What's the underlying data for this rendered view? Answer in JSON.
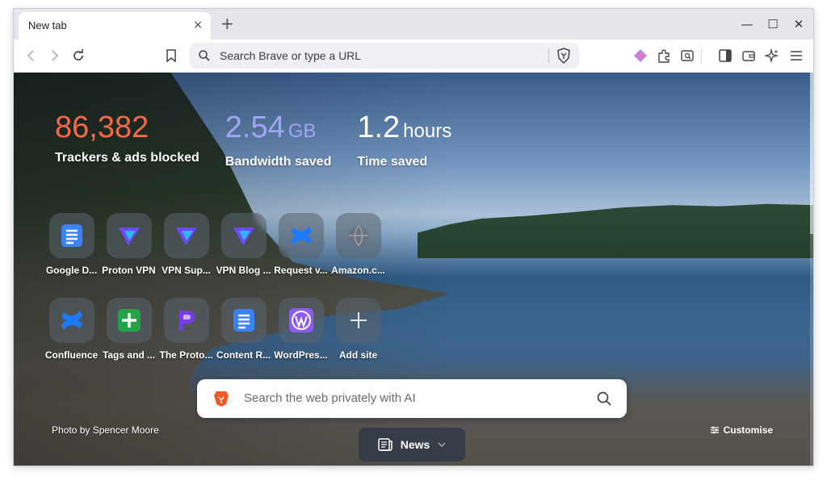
{
  "tab": {
    "title": "New tab",
    "close": "×",
    "new": "+"
  },
  "window": {
    "minimize": "—",
    "maximize": "☐",
    "close": "✕"
  },
  "omnibox": {
    "placeholder": "Search Brave or type a URL"
  },
  "stats": [
    {
      "value": "86,382",
      "unit": "",
      "label": "Trackers & ads blocked",
      "color": "#f26a4b"
    },
    {
      "value": "2.54",
      "unit": "GB",
      "label": "Bandwidth saved",
      "color": "#a0a6f5"
    },
    {
      "value": "1.2",
      "unit": "hours",
      "label": "Time saved",
      "color": "#ffffff"
    }
  ],
  "tiles": [
    {
      "label": "Google D...",
      "icon": "google-docs-icon"
    },
    {
      "label": "Proton VPN",
      "icon": "proton-vpn-icon"
    },
    {
      "label": "VPN Sup...",
      "icon": "proton-vpn-icon"
    },
    {
      "label": "VPN Blog ...",
      "icon": "proton-vpn-icon"
    },
    {
      "label": "Request v...",
      "icon": "confluence-icon"
    },
    {
      "label": "Amazon.c...",
      "icon": "globe-icon"
    },
    {
      "label": "Confluence",
      "icon": "confluence-icon"
    },
    {
      "label": "Tags and ...",
      "icon": "plus-green-icon"
    },
    {
      "label": "The Proto...",
      "icon": "proton-pass-icon"
    },
    {
      "label": "Content R...",
      "icon": "google-docs-icon"
    },
    {
      "label": "WordPres...",
      "icon": "wordpress-icon"
    },
    {
      "label": "Add site",
      "icon": "add-site-icon"
    }
  ],
  "ai_search": {
    "placeholder": "Search the web privately with AI"
  },
  "photo_credit": "Photo by Spencer Moore",
  "customise_label": "Customise",
  "news_label": "News"
}
